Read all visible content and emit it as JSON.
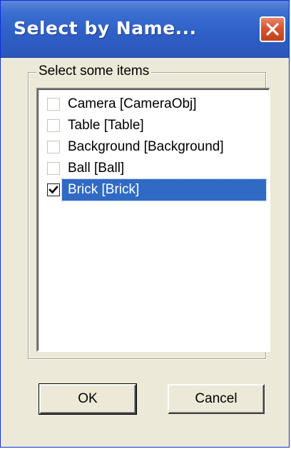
{
  "window": {
    "title": "Select by Name...",
    "close_icon": "close-x-icon",
    "colors": {
      "titlebar": "#2f60c8",
      "face": "#ece9d8",
      "selection": "#316ac5",
      "close": "#d8552f"
    }
  },
  "group": {
    "label": "Select some items"
  },
  "items": [
    {
      "label": "Camera  [CameraObj]",
      "checked": false,
      "selected": false
    },
    {
      "label": "Table  [Table]",
      "checked": false,
      "selected": false
    },
    {
      "label": "Background  [Background]",
      "checked": false,
      "selected": false
    },
    {
      "label": "Ball  [Ball]",
      "checked": false,
      "selected": false
    },
    {
      "label": "Brick  [Brick]",
      "checked": true,
      "selected": true
    }
  ],
  "buttons": {
    "ok_label": "OK",
    "cancel_label": "Cancel"
  }
}
